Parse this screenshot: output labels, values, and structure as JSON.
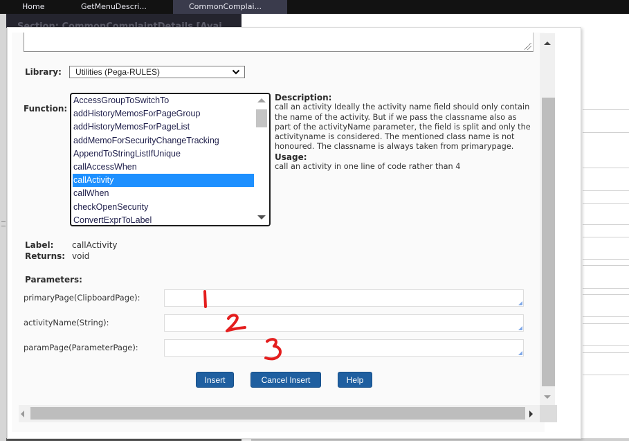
{
  "tabs": [
    {
      "label": "Home",
      "active": false
    },
    {
      "label": "GetMenuDescri...",
      "active": false
    },
    {
      "label": "CommonComplai...",
      "active": true
    }
  ],
  "background": {
    "section_header": "Section: CommonComplaintDetails [Avai"
  },
  "dialog": {
    "library": {
      "label": "Library:",
      "selected": "Utilities (Pega-RULES)"
    },
    "function": {
      "label": "Function:",
      "items": [
        "AccessGroupToSwitchTo",
        "addHistoryMemosForPageGroup",
        "addHistoryMemosForPageList",
        "addMemoForSecurityChangeTracking",
        "AppendToStringListIfUnique",
        "callAccessWhen",
        "callActivity",
        "callWhen",
        "checkOpenSecurity",
        "ConvertExprToLabel"
      ],
      "selected_index": 6
    },
    "description": {
      "heading": "Description:",
      "text": "call an activity Ideally the activity name field should only contain the name of the activity. But if we pass the classname also as part of the activityName parameter, the field is split and only the activityname is considered. The mentioned class name is not honoured. The classname is always taken from primarypage.",
      "usage_heading": "Usage:",
      "usage_text": "call an activity in one line of code rather than 4"
    },
    "info": {
      "label_key": "Label:",
      "label_value": "callActivity",
      "returns_key": "Returns:",
      "returns_value": "void"
    },
    "parameters": {
      "heading": "Parameters:",
      "items": [
        {
          "label": "primaryPage(ClipboardPage):",
          "value": ""
        },
        {
          "label": "activityName(String):",
          "value": ""
        },
        {
          "label": "paramPage(ParameterPage):",
          "value": ""
        }
      ]
    },
    "buttons": {
      "insert": "Insert",
      "cancel_insert": "Cancel Insert",
      "help": "Help"
    }
  },
  "annotations": [
    "1",
    "2",
    "3"
  ],
  "colors": {
    "selection": "#1e90ff",
    "button": "#1f5fa0",
    "annotation": "#e41e1e"
  }
}
